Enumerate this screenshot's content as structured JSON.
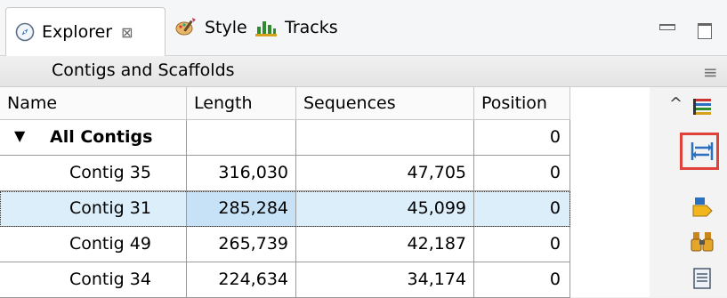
{
  "tabs": [
    {
      "label": "Explorer",
      "icon": "compass-icon",
      "active": true
    },
    {
      "label": "Style",
      "icon": "paint-brush-icon",
      "active": false
    },
    {
      "label": "Tracks",
      "icon": "tracks-chart-icon",
      "active": false
    }
  ],
  "tab_close_symbol": "⊠",
  "panel": {
    "title": "Contigs and Scaffolds",
    "menu_icon": "hamburger-menu-icon"
  },
  "table": {
    "columns": [
      "Name",
      "Length",
      "Sequences",
      "Position"
    ],
    "rows": [
      {
        "name": "All Contigs",
        "length": "",
        "sequences": "",
        "position": "0",
        "expanded": true
      },
      {
        "name": "Contig 35",
        "length": "316,030",
        "sequences": "47,705",
        "position": "0"
      },
      {
        "name": "Contig 31",
        "length": "285,284",
        "sequences": "45,099",
        "position": "0",
        "selected": true
      },
      {
        "name": "Contig 49",
        "length": "265,739",
        "sequences": "42,187",
        "position": "0"
      },
      {
        "name": "Contig 34",
        "length": "224,634",
        "sequences": "34,174",
        "position": "0"
      }
    ]
  },
  "toolbar": {
    "icons": [
      "color-bars-icon",
      "swap-arrows-icon",
      "export-arrow-icon",
      "binoculars-icon",
      "document-icon"
    ],
    "highlight_color": "#e0413b"
  },
  "colors": {
    "selection": "#dbeefa",
    "accent_blue": "#2b6cc4"
  }
}
